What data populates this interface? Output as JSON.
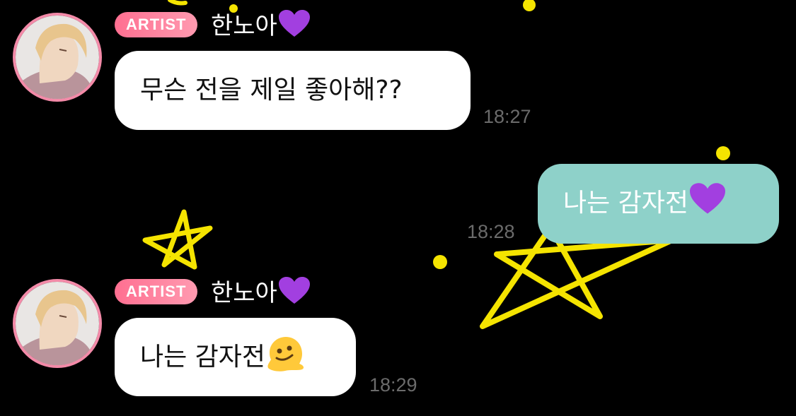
{
  "messages": [
    {
      "type": "received",
      "badge": "ARTIST",
      "sender": "한노아",
      "text": "무슨 전을 제일 좋아해??",
      "time": "18:27",
      "name_emoji": "purple-heart-icon"
    },
    {
      "type": "sent",
      "text": "나는 감자전",
      "time": "18:28",
      "emoji": "purple-heart-icon"
    },
    {
      "type": "received",
      "badge": "ARTIST",
      "sender": "한노아",
      "text": "나는 감자전",
      "time": "18:29",
      "name_emoji": "purple-heart-icon",
      "emoji": "melting-face-icon"
    }
  ],
  "colors": {
    "background": "#000000",
    "badge": "#ff7a98",
    "avatar_ring": "#f38aa8",
    "sent_bubble": "#8ed1c9",
    "received_bubble": "#ffffff",
    "doodle": "#f5e400",
    "timestamp": "#6b6b6b",
    "heart": "#a23fe0"
  }
}
